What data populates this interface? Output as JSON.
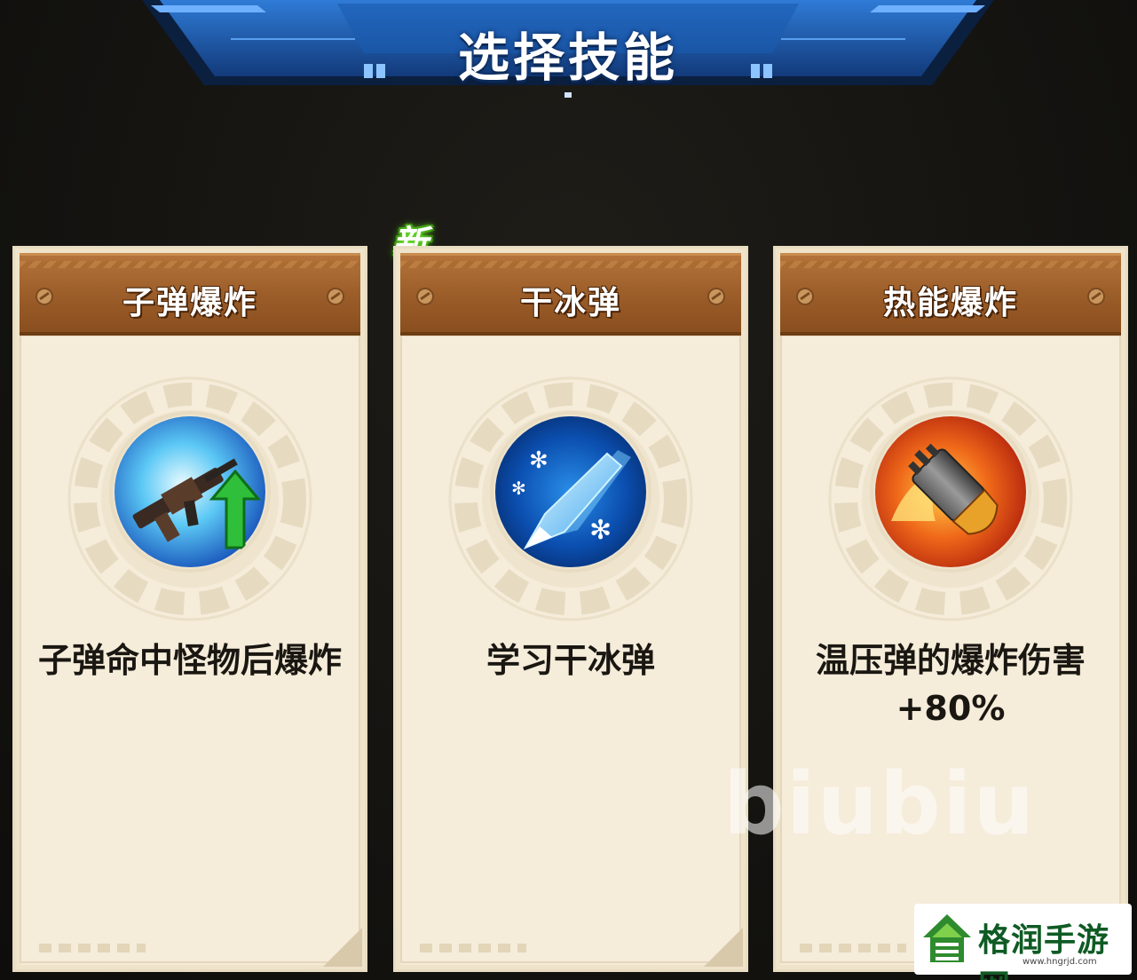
{
  "header": {
    "title": "选择技能"
  },
  "cards": [
    {
      "title": "子弹爆炸",
      "icon": "rifle-upgrade-icon",
      "description": "子弹命中怪物后爆炸",
      "is_new": false
    },
    {
      "title": "干冰弹",
      "icon": "ice-bullet-icon",
      "description": "学习干冰弹",
      "is_new": true
    },
    {
      "title": "热能爆炸",
      "icon": "fire-bullet-icon",
      "description": "温压弹的爆炸伤害+80%",
      "is_new": false
    }
  ],
  "badge": {
    "new_label": "新"
  },
  "watermark": {
    "text": "biubiu"
  },
  "site": {
    "name": "格润手游网",
    "url": "www.hngrjd.com"
  },
  "colors": {
    "banner_blue": "#1f5fb8",
    "card_header_brown": "#9a5c28",
    "card_paper": "#f4ead6",
    "new_green": "#5fd11f"
  }
}
